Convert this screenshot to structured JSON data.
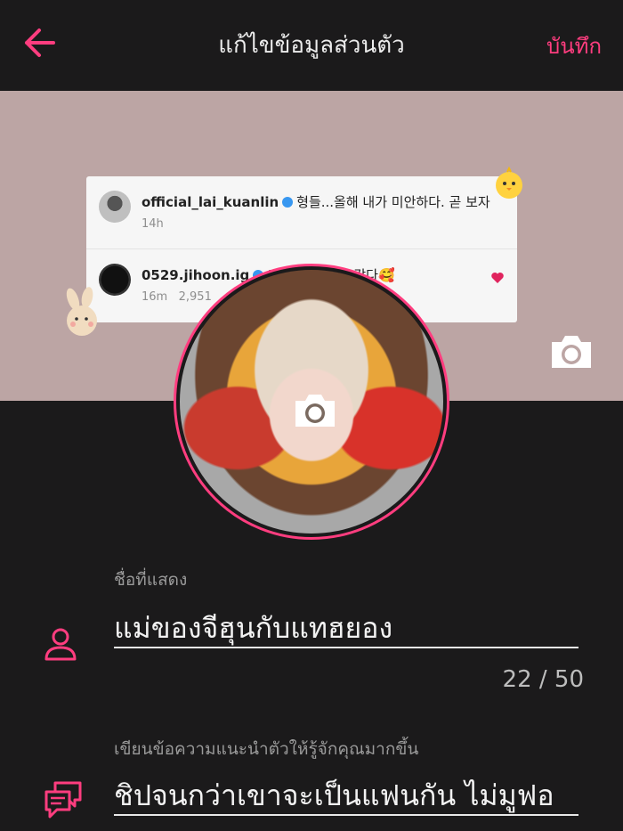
{
  "header": {
    "title": "แก้ไขข้อมูลส่วนตัว",
    "save_label": "บันทึก",
    "accent_color": "#ff3d7f"
  },
  "cover": {
    "ig_posts": [
      {
        "username": "official_lai_kuanlin",
        "text": "형들...올해 내가 미안하다. 곧 보자",
        "time": "14h"
      },
      {
        "username": "0529.jihoon.ig",
        "text": "모든 은은 항상 같다🥰",
        "time": "16m",
        "likes": "2,951"
      }
    ]
  },
  "profile": {
    "display_name_label": "ชื่อที่แสดง",
    "display_name": "แม่ของจีฮุนกับแทฮยอง",
    "counter": "22 / 50",
    "bio_label": "เขียนข้อความแนะนำตัวให้รู้จักคุณมากขึ้น",
    "bio": "ชิปจนกว่าเขาจะเป็นแฟนกัน  ไม่มูฟอ"
  },
  "icons": {
    "back": "arrow-left-icon",
    "camera": "camera-icon",
    "user": "user-icon",
    "chat": "chat-bubbles-icon"
  }
}
